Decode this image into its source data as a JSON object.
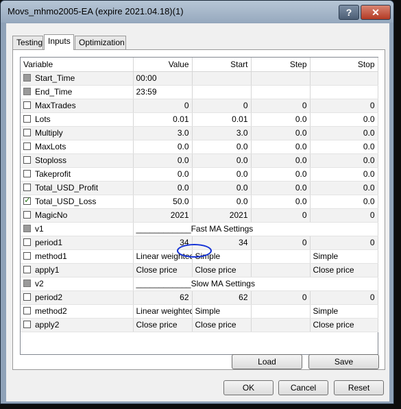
{
  "window": {
    "title": "Movs_mhmo2005-EA (expire 2021.04.18)(1)",
    "help_label": "?",
    "close_label": "✕"
  },
  "tabs": [
    {
      "label": "Testing"
    },
    {
      "label": "Inputs"
    },
    {
      "label": "Optimization"
    }
  ],
  "table": {
    "headers": [
      "Variable",
      "Value",
      "Start",
      "Step",
      "Stop"
    ],
    "rows": [
      {
        "variable": "Start_Time",
        "value": "00:00",
        "start": "",
        "step": "",
        "stop": "",
        "check": "grey"
      },
      {
        "variable": "End_Time",
        "value": "23:59",
        "start": "",
        "step": "",
        "stop": "",
        "check": "grey"
      },
      {
        "variable": "MaxTrades",
        "value": "0",
        "start": "0",
        "step": "0",
        "stop": "0",
        "check": "off"
      },
      {
        "variable": "Lots",
        "value": "0.01",
        "start": "0.01",
        "step": "0.0",
        "stop": "0.0",
        "check": "off"
      },
      {
        "variable": "Multiply",
        "value": "3.0",
        "start": "3.0",
        "step": "0.0",
        "stop": "0.0",
        "check": "off"
      },
      {
        "variable": "MaxLots",
        "value": "0.0",
        "start": "0.0",
        "step": "0.0",
        "stop": "0.0",
        "check": "off"
      },
      {
        "variable": "Stoploss",
        "value": "0.0",
        "start": "0.0",
        "step": "0.0",
        "stop": "0.0",
        "check": "off"
      },
      {
        "variable": "Takeprofit",
        "value": "0.0",
        "start": "0.0",
        "step": "0.0",
        "stop": "0.0",
        "check": "off"
      },
      {
        "variable": "Total_USD_Profit",
        "value": "0.0",
        "start": "0.0",
        "step": "0.0",
        "stop": "0.0",
        "check": "off"
      },
      {
        "variable": "Total_USD_Loss",
        "value": "50.0",
        "start": "0.0",
        "step": "0.0",
        "stop": "0.0",
        "check": "on"
      },
      {
        "variable": "MagicNo",
        "value": "2021",
        "start": "2021",
        "step": "0",
        "stop": "0",
        "check": "off"
      },
      {
        "variable": "v1",
        "value": "____________Fast MA Settings",
        "start": "",
        "step": "",
        "stop": "",
        "check": "grey"
      },
      {
        "variable": "period1",
        "value": "34",
        "start": "34",
        "step": "0",
        "stop": "0",
        "check": "off"
      },
      {
        "variable": "method1",
        "value": "Linear weighted",
        "start": "Simple",
        "step": "",
        "stop": "Simple",
        "check": "off"
      },
      {
        "variable": "apply1",
        "value": "Close price",
        "start": "Close price",
        "step": "",
        "stop": "Close price",
        "check": "off"
      },
      {
        "variable": "v2",
        "value": "____________Slow MA Settings",
        "start": "",
        "step": "",
        "stop": "",
        "check": "grey"
      },
      {
        "variable": "period2",
        "value": "62",
        "start": "62",
        "step": "0",
        "stop": "0",
        "check": "off"
      },
      {
        "variable": "method2",
        "value": "Linear weighted",
        "start": "Simple",
        "step": "",
        "stop": "Simple",
        "check": "off"
      },
      {
        "variable": "apply2",
        "value": "Close price",
        "start": "Close price",
        "step": "",
        "stop": "Close price",
        "check": "off"
      }
    ]
  },
  "panel_buttons": {
    "load": "Load",
    "save": "Save"
  },
  "dialog_buttons": {
    "ok": "OK",
    "cancel": "Cancel",
    "reset": "Reset"
  },
  "colors": {
    "title_bar": "#a9bace",
    "close_button": "#c44a33",
    "annotation_circle": "#1533d6",
    "checkmark": "#2a7a1c"
  },
  "icons": [
    "help-icon",
    "close-icon",
    "checkbox-icon"
  ]
}
